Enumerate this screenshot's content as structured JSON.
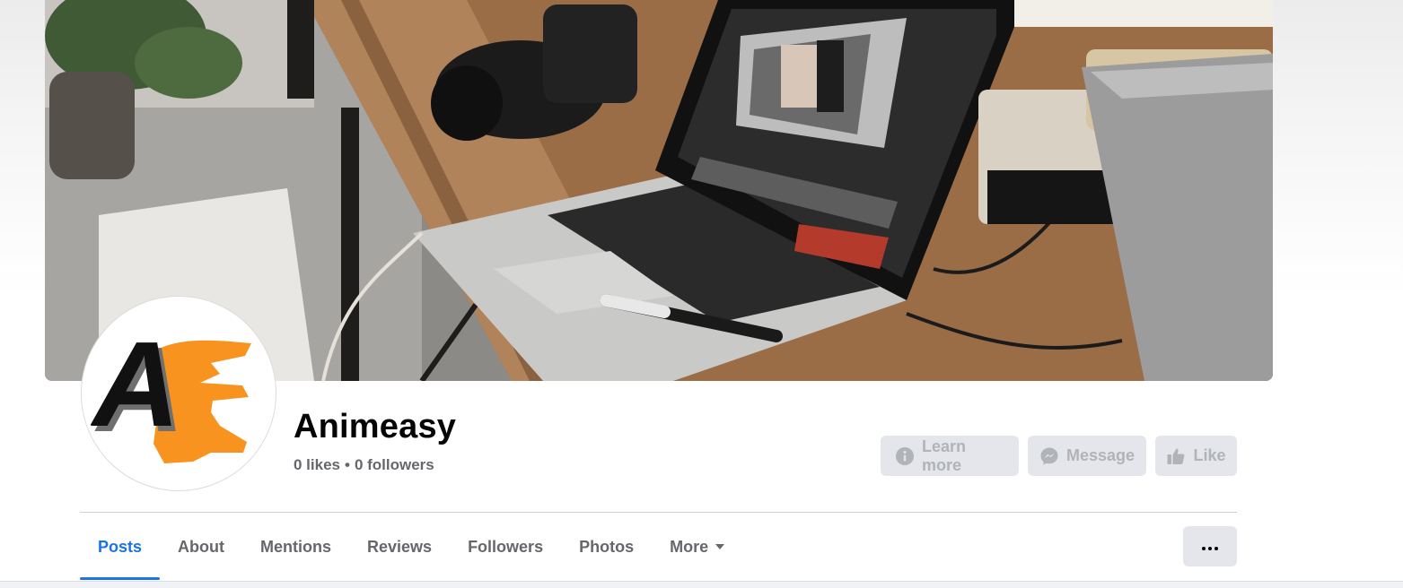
{
  "page": {
    "name": "Animeasy",
    "stats": {
      "likes": "0 likes",
      "separator": "•",
      "followers": "0 followers"
    }
  },
  "avatar": {
    "logo_letter_1": "A",
    "logo_letter_2": "E",
    "logo_colors": {
      "letter_1": "#111111",
      "letter_2": "#f7931e"
    }
  },
  "actions": {
    "learn_more": {
      "label": "Learn more",
      "icon": "info-icon"
    },
    "message": {
      "label": "Message",
      "icon": "messenger-icon"
    },
    "like": {
      "label": "Like",
      "icon": "thumbs-up-icon"
    }
  },
  "tabs": [
    {
      "label": "Posts",
      "active": true
    },
    {
      "label": "About",
      "active": false
    },
    {
      "label": "Mentions",
      "active": false
    },
    {
      "label": "Reviews",
      "active": false
    },
    {
      "label": "Followers",
      "active": false
    },
    {
      "label": "Photos",
      "active": false
    },
    {
      "label": "More",
      "active": false,
      "icon": "caret-down-icon"
    }
  ],
  "more_options": {
    "label": "...",
    "icon": "ellipsis-icon"
  },
  "colors": {
    "accent": "#1b74e4",
    "button_bg": "#e4e6eb",
    "button_text_disabled": "#b0b3b8",
    "secondary_text": "#65676b"
  }
}
